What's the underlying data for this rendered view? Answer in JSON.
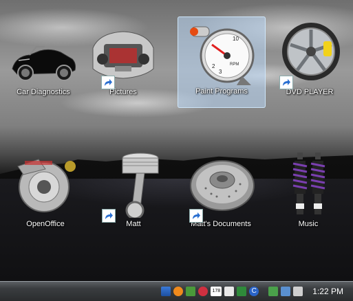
{
  "desktop": {
    "icons": [
      {
        "label": "Car Diagnostics",
        "shortcut": false,
        "selected": false
      },
      {
        "label": "Pictures",
        "shortcut": true,
        "selected": false
      },
      {
        "label": "Paint Programs",
        "shortcut": false,
        "selected": true
      },
      {
        "label": "DVD PLAYER",
        "shortcut": true,
        "selected": false
      },
      {
        "label": "OpenOffice",
        "shortcut": false,
        "selected": false
      },
      {
        "label": "Matt",
        "shortcut": true,
        "selected": false
      },
      {
        "label": "Matt's Documents",
        "shortcut": true,
        "selected": false
      },
      {
        "label": "Music",
        "shortcut": false,
        "selected": false
      }
    ],
    "gauge_text": "RPM"
  },
  "taskbar": {
    "clock": "1:22 PM",
    "tray_icons": [
      "security-shield-icon",
      "orange-app-icon",
      "green-app-icon",
      "red-app-icon",
      "calendar-icon",
      "mail-icon",
      "c-app-icon",
      "network-icon",
      "monitor-icon",
      "volume-icon"
    ],
    "tray_date_text": "178"
  }
}
